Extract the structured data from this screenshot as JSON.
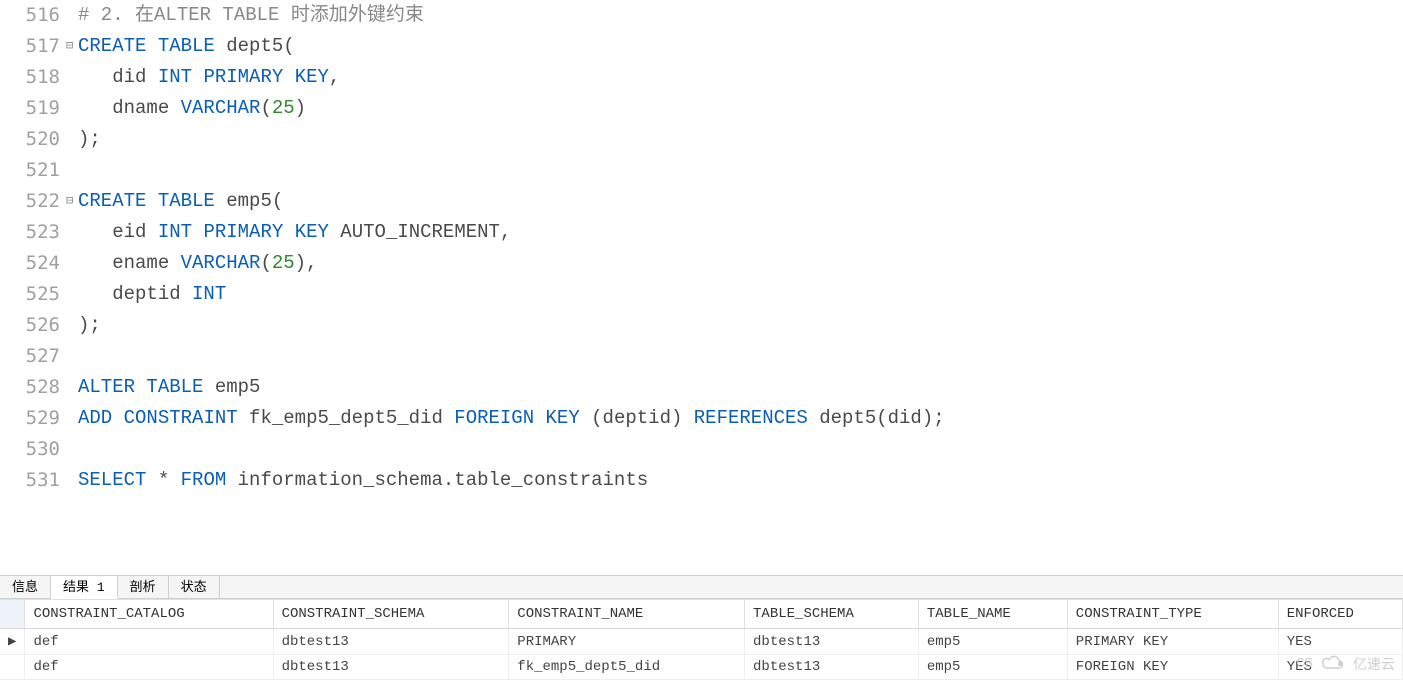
{
  "code": {
    "lines": [
      {
        "n": "516",
        "fold": "",
        "tokens": [
          {
            "cls": "cmt",
            "t": "# 2. 在ALTER TABLE 时添加外键约束"
          }
        ]
      },
      {
        "n": "517",
        "fold": "⊟",
        "tokens": [
          {
            "cls": "kw",
            "t": "CREATE"
          },
          {
            "cls": "",
            "t": " "
          },
          {
            "cls": "kw",
            "t": "TABLE"
          },
          {
            "cls": "",
            "t": " dept5("
          }
        ]
      },
      {
        "n": "518",
        "fold": "",
        "tokens": [
          {
            "cls": "",
            "t": "   did "
          },
          {
            "cls": "dt",
            "t": "INT"
          },
          {
            "cls": "",
            "t": " "
          },
          {
            "cls": "kw",
            "t": "PRIMARY"
          },
          {
            "cls": "",
            "t": " "
          },
          {
            "cls": "kw",
            "t": "KEY"
          },
          {
            "cls": "pn",
            "t": ","
          }
        ]
      },
      {
        "n": "519",
        "fold": "",
        "tokens": [
          {
            "cls": "",
            "t": "   dname "
          },
          {
            "cls": "dt",
            "t": "VARCHAR"
          },
          {
            "cls": "pn",
            "t": "("
          },
          {
            "cls": "num",
            "t": "25"
          },
          {
            "cls": "pn",
            "t": ")"
          }
        ]
      },
      {
        "n": "520",
        "fold": "",
        "tokens": [
          {
            "cls": "pn",
            "t": ");"
          }
        ]
      },
      {
        "n": "521",
        "fold": "",
        "tokens": [
          {
            "cls": "",
            "t": ""
          }
        ]
      },
      {
        "n": "522",
        "fold": "⊟",
        "tokens": [
          {
            "cls": "kw",
            "t": "CREATE"
          },
          {
            "cls": "",
            "t": " "
          },
          {
            "cls": "kw",
            "t": "TABLE"
          },
          {
            "cls": "",
            "t": " emp5("
          }
        ]
      },
      {
        "n": "523",
        "fold": "",
        "tokens": [
          {
            "cls": "",
            "t": "   eid "
          },
          {
            "cls": "dt",
            "t": "INT"
          },
          {
            "cls": "",
            "t": " "
          },
          {
            "cls": "kw",
            "t": "PRIMARY"
          },
          {
            "cls": "",
            "t": " "
          },
          {
            "cls": "kw",
            "t": "KEY"
          },
          {
            "cls": "",
            "t": " AUTO_INCREMENT"
          },
          {
            "cls": "pn",
            "t": ","
          }
        ]
      },
      {
        "n": "524",
        "fold": "",
        "tokens": [
          {
            "cls": "",
            "t": "   ename "
          },
          {
            "cls": "dt",
            "t": "VARCHAR"
          },
          {
            "cls": "pn",
            "t": "("
          },
          {
            "cls": "num",
            "t": "25"
          },
          {
            "cls": "pn",
            "t": ")"
          },
          {
            "cls": "pn",
            "t": ","
          }
        ]
      },
      {
        "n": "525",
        "fold": "",
        "tokens": [
          {
            "cls": "",
            "t": "   deptid "
          },
          {
            "cls": "dt",
            "t": "INT"
          }
        ]
      },
      {
        "n": "526",
        "fold": "",
        "tokens": [
          {
            "cls": "pn",
            "t": ");"
          }
        ]
      },
      {
        "n": "527",
        "fold": "",
        "tokens": [
          {
            "cls": "",
            "t": ""
          }
        ]
      },
      {
        "n": "528",
        "fold": "",
        "tokens": [
          {
            "cls": "kw",
            "t": "ALTER"
          },
          {
            "cls": "",
            "t": " "
          },
          {
            "cls": "kw",
            "t": "TABLE"
          },
          {
            "cls": "",
            "t": " emp5"
          }
        ]
      },
      {
        "n": "529",
        "fold": "",
        "tokens": [
          {
            "cls": "kw",
            "t": "ADD"
          },
          {
            "cls": "",
            "t": " "
          },
          {
            "cls": "kw",
            "t": "CONSTRAINT"
          },
          {
            "cls": "",
            "t": " fk_emp5_dept5_did "
          },
          {
            "cls": "kw",
            "t": "FOREIGN"
          },
          {
            "cls": "",
            "t": " "
          },
          {
            "cls": "kw",
            "t": "KEY"
          },
          {
            "cls": "",
            "t": " (deptid) "
          },
          {
            "cls": "kw",
            "t": "REFERENCES"
          },
          {
            "cls": "",
            "t": " dept5(did);"
          }
        ]
      },
      {
        "n": "530",
        "fold": "",
        "tokens": [
          {
            "cls": "",
            "t": ""
          }
        ]
      },
      {
        "n": "531",
        "fold": "",
        "tokens": [
          {
            "cls": "kw",
            "t": "SELECT"
          },
          {
            "cls": "",
            "t": " * "
          },
          {
            "cls": "kw",
            "t": "FROM"
          },
          {
            "cls": "",
            "t": " information_schema.table_constraints"
          }
        ]
      }
    ]
  },
  "tabs": {
    "items": [
      {
        "label": "信息",
        "active": false
      },
      {
        "label": "结果 1",
        "active": true
      },
      {
        "label": "剖析",
        "active": false
      },
      {
        "label": "状态",
        "active": false
      }
    ]
  },
  "results": {
    "columns": [
      "CONSTRAINT_CATALOG",
      "CONSTRAINT_SCHEMA",
      "CONSTRAINT_NAME",
      "TABLE_SCHEMA",
      "TABLE_NAME",
      "CONSTRAINT_TYPE",
      "ENFORCED"
    ],
    "rows": [
      {
        "marker": "▶",
        "cells": [
          "def",
          "dbtest13",
          "PRIMARY",
          "dbtest13",
          "emp5",
          "PRIMARY KEY",
          "YES"
        ]
      },
      {
        "marker": "",
        "cells": [
          "def",
          "dbtest13",
          "fk_emp5_dept5_did",
          "dbtest13",
          "emp5",
          "FOREIGN KEY",
          "YES"
        ]
      }
    ]
  },
  "watermark": {
    "prefix": "CS",
    "brand": "亿速云"
  }
}
